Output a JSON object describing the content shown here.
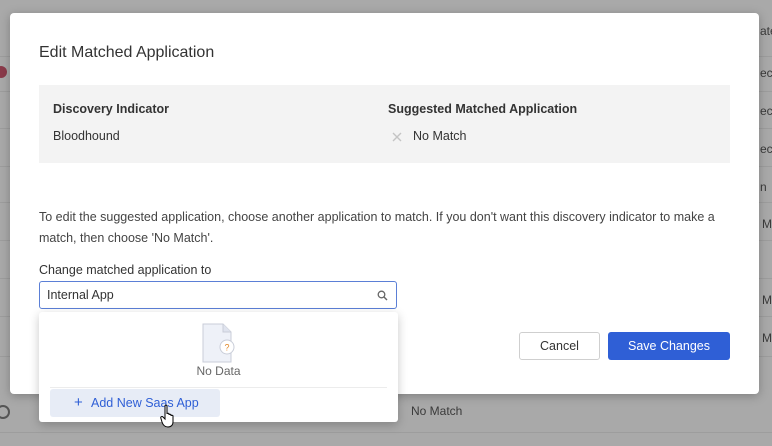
{
  "background": {
    "right_texts": [
      "ate",
      "ecl",
      "ecl",
      "ecl",
      "n",
      "M",
      "M",
      "M"
    ],
    "bottom_text": "No Match"
  },
  "modal": {
    "title": "Edit Matched Application",
    "info": {
      "indicator_header": "Discovery Indicator",
      "indicator_value": "Bloodhound",
      "suggested_header": "Suggested Matched Application",
      "suggested_value": "No Match",
      "suggested_icon": "x-icon"
    },
    "description": "To edit the suggested application, choose another application to match. If you don't want this discovery indicator to make a match, then choose 'No Match'.",
    "field_label": "Change matched application to",
    "search": {
      "value": "Internal App",
      "icon": "search-icon"
    },
    "cancel_label": "Cancel",
    "save_label": "Save Changes"
  },
  "dropdown": {
    "empty_text": "No Data",
    "empty_icon": "no-data-file-icon",
    "add_label": "Add New Saas App"
  },
  "colors": {
    "primary": "#2f5fd6",
    "overlay": "#a9a9a9",
    "info_bg": "#f3f3f3",
    "add_bg": "#e7ecf6"
  }
}
